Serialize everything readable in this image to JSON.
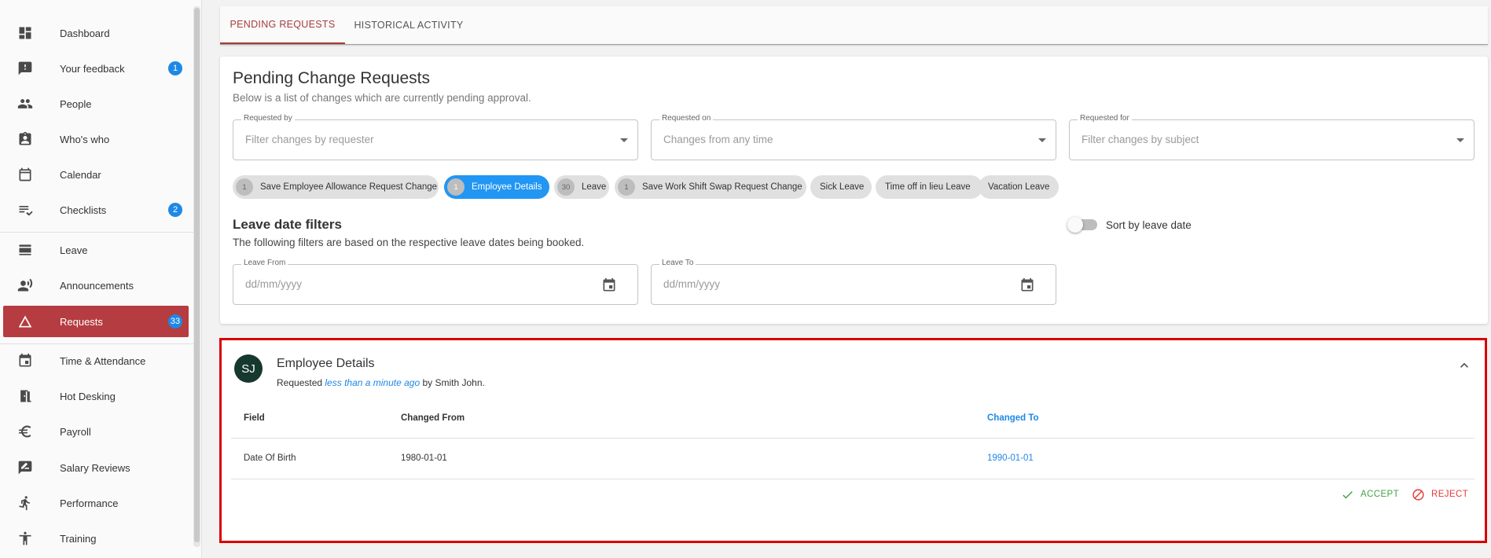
{
  "sidebar": {
    "items": [
      {
        "label": "Dashboard",
        "icon": "dashboard-icon"
      },
      {
        "label": "Your feedback",
        "icon": "feedback-icon",
        "badge": "1"
      },
      {
        "label": "People",
        "icon": "people-icon"
      },
      {
        "label": "Who's who",
        "icon": "badge-icon"
      },
      {
        "label": "Calendar",
        "icon": "calendar-icon"
      },
      {
        "label": "Checklists",
        "icon": "checklist-icon",
        "badge": "2"
      },
      {
        "label": "Leave",
        "icon": "leave-icon"
      },
      {
        "label": "Announcements",
        "icon": "announcement-icon"
      },
      {
        "label": "Requests",
        "icon": "warning-triangle-icon",
        "badge": "33",
        "active": true
      },
      {
        "label": "Time & Attendance",
        "icon": "event-icon"
      },
      {
        "label": "Hot Desking",
        "icon": "door-icon"
      },
      {
        "label": "Payroll",
        "icon": "euro-icon"
      },
      {
        "label": "Salary Reviews",
        "icon": "rate-review-icon"
      },
      {
        "label": "Performance",
        "icon": "running-icon"
      },
      {
        "label": "Training",
        "icon": "accessibility-icon"
      }
    ]
  },
  "tabs": {
    "pending": "PENDING REQUESTS",
    "historical": "HISTORICAL ACTIVITY"
  },
  "filters": {
    "title": "Pending Change Requests",
    "subtitle": "Below is a list of changes which are currently pending approval.",
    "requested_by": {
      "label": "Requested by",
      "placeholder": "Filter changes by requester"
    },
    "requested_on": {
      "label": "Requested on",
      "placeholder": "Changes from any time"
    },
    "requested_for": {
      "label": "Requested for",
      "placeholder": "Filter changes by subject"
    },
    "chips": [
      {
        "count": "1",
        "label": "Save Employee Allowance Request Change"
      },
      {
        "count": "1",
        "label": "Employee Details",
        "selected": true
      },
      {
        "count": "30",
        "label": "Leave"
      },
      {
        "count": "1",
        "label": "Save Work Shift Swap Request Change"
      },
      {
        "label": "Sick Leave"
      },
      {
        "label": "Time off in lieu Leave"
      },
      {
        "label": "Vacation Leave"
      }
    ],
    "leave_title": "Leave date filters",
    "leave_subtitle": "The following filters are based on the respective leave dates being booked.",
    "leave_from": {
      "label": "Leave From",
      "placeholder": "dd/mm/yyyy"
    },
    "leave_to": {
      "label": "Leave To",
      "placeholder": "dd/mm/yyyy"
    },
    "sort_label": "Sort by leave date",
    "sort_enabled": false
  },
  "request": {
    "avatar": "SJ",
    "title": "Employee Details",
    "requested_prefix": "Requested",
    "requested_time": "less than a minute ago",
    "requested_by": "by Smith John.",
    "columns": {
      "field": "Field",
      "from": "Changed From",
      "to": "Changed To"
    },
    "rows": [
      {
        "field": "Date Of Birth",
        "from": "1980-01-01",
        "to": "1990-01-01"
      }
    ],
    "accept": "ACCEPT",
    "reject": "REJECT"
  },
  "colors": {
    "accent": "#a53e3a",
    "active_nav": "#b53c40",
    "badge": "#1e88e5",
    "selected_chip": "#2196f3",
    "highlight_border": "#d90000",
    "accept": "#43a047",
    "reject": "#e53935"
  }
}
